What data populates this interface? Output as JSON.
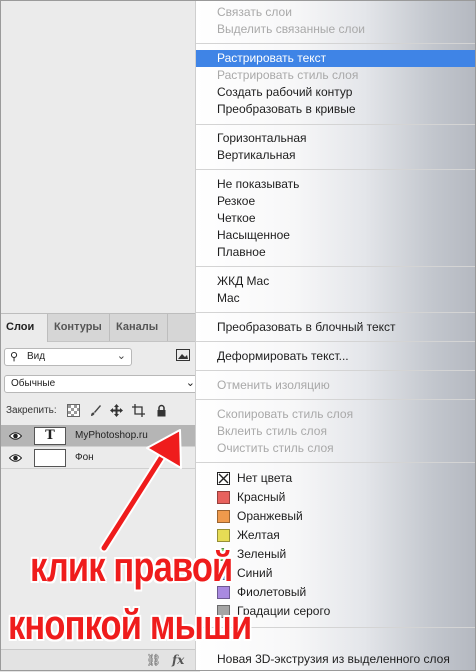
{
  "panel": {
    "tabs": [
      "Слои",
      "Контуры",
      "Каналы"
    ],
    "filter_label": "Вид",
    "blend_mode": "Обычные",
    "lock_label": "Закрепить:",
    "layers": [
      {
        "name": "MyPhotoshop.ru",
        "thumb": "T",
        "selected": true
      },
      {
        "name": "Фон",
        "thumb": "",
        "selected": false
      }
    ],
    "bottom_fx": "fx"
  },
  "menu": {
    "items": [
      {
        "label": "Связать слои",
        "state": "disabled"
      },
      {
        "label": "Выделить связанные слои",
        "state": "disabled"
      },
      {
        "label": "Растрировать текст",
        "state": "highlighted"
      },
      {
        "label": "Растрировать стиль слоя",
        "state": "disabled"
      },
      {
        "label": "Создать рабочий контур",
        "state": "normal"
      },
      {
        "label": "Преобразовать в кривые",
        "state": "normal"
      },
      {
        "label": "Горизонтальная",
        "state": "normal"
      },
      {
        "label": "Вертикальная",
        "state": "normal"
      },
      {
        "label": "Не показывать",
        "state": "normal"
      },
      {
        "label": "Резкое",
        "state": "normal"
      },
      {
        "label": "Четкое",
        "state": "normal"
      },
      {
        "label": "Насыщенное",
        "state": "normal"
      },
      {
        "label": "Плавное",
        "state": "normal"
      },
      {
        "label": "ЖКД Mac",
        "state": "normal"
      },
      {
        "label": "Mac",
        "state": "normal"
      },
      {
        "label": "Преобразовать в блочный текст",
        "state": "normal"
      },
      {
        "label": "Деформировать текст...",
        "state": "normal"
      },
      {
        "label": "Отменить изоляцию",
        "state": "disabled"
      },
      {
        "label": "Скопировать стиль слоя",
        "state": "disabled"
      },
      {
        "label": "Вклеить стиль слоя",
        "state": "disabled"
      },
      {
        "label": "Очистить стиль слоя",
        "state": "disabled"
      }
    ],
    "colors": [
      {
        "label": "Нет цвета",
        "color": "none"
      },
      {
        "label": "Красный",
        "color": "#e8615d"
      },
      {
        "label": "Оранжевый",
        "color": "#ef9a4c"
      },
      {
        "label": "Желтая",
        "color": "#e6dc55"
      },
      {
        "label": "Зеленый",
        "color": "#7ed26a"
      },
      {
        "label": "Синий",
        "color": "#6aa5e8"
      },
      {
        "label": "Фиолетовый",
        "color": "#a98ae0"
      },
      {
        "label": "Градации серого",
        "color": "#a5a5a5"
      }
    ],
    "last_items": [
      {
        "label": "Новая 3D-экструзия из выделенного слоя",
        "state": "normal"
      }
    ]
  },
  "annotation": {
    "line1": "клик правой",
    "line2": "кнопкой мыши",
    "color": "#ef1c1c"
  }
}
